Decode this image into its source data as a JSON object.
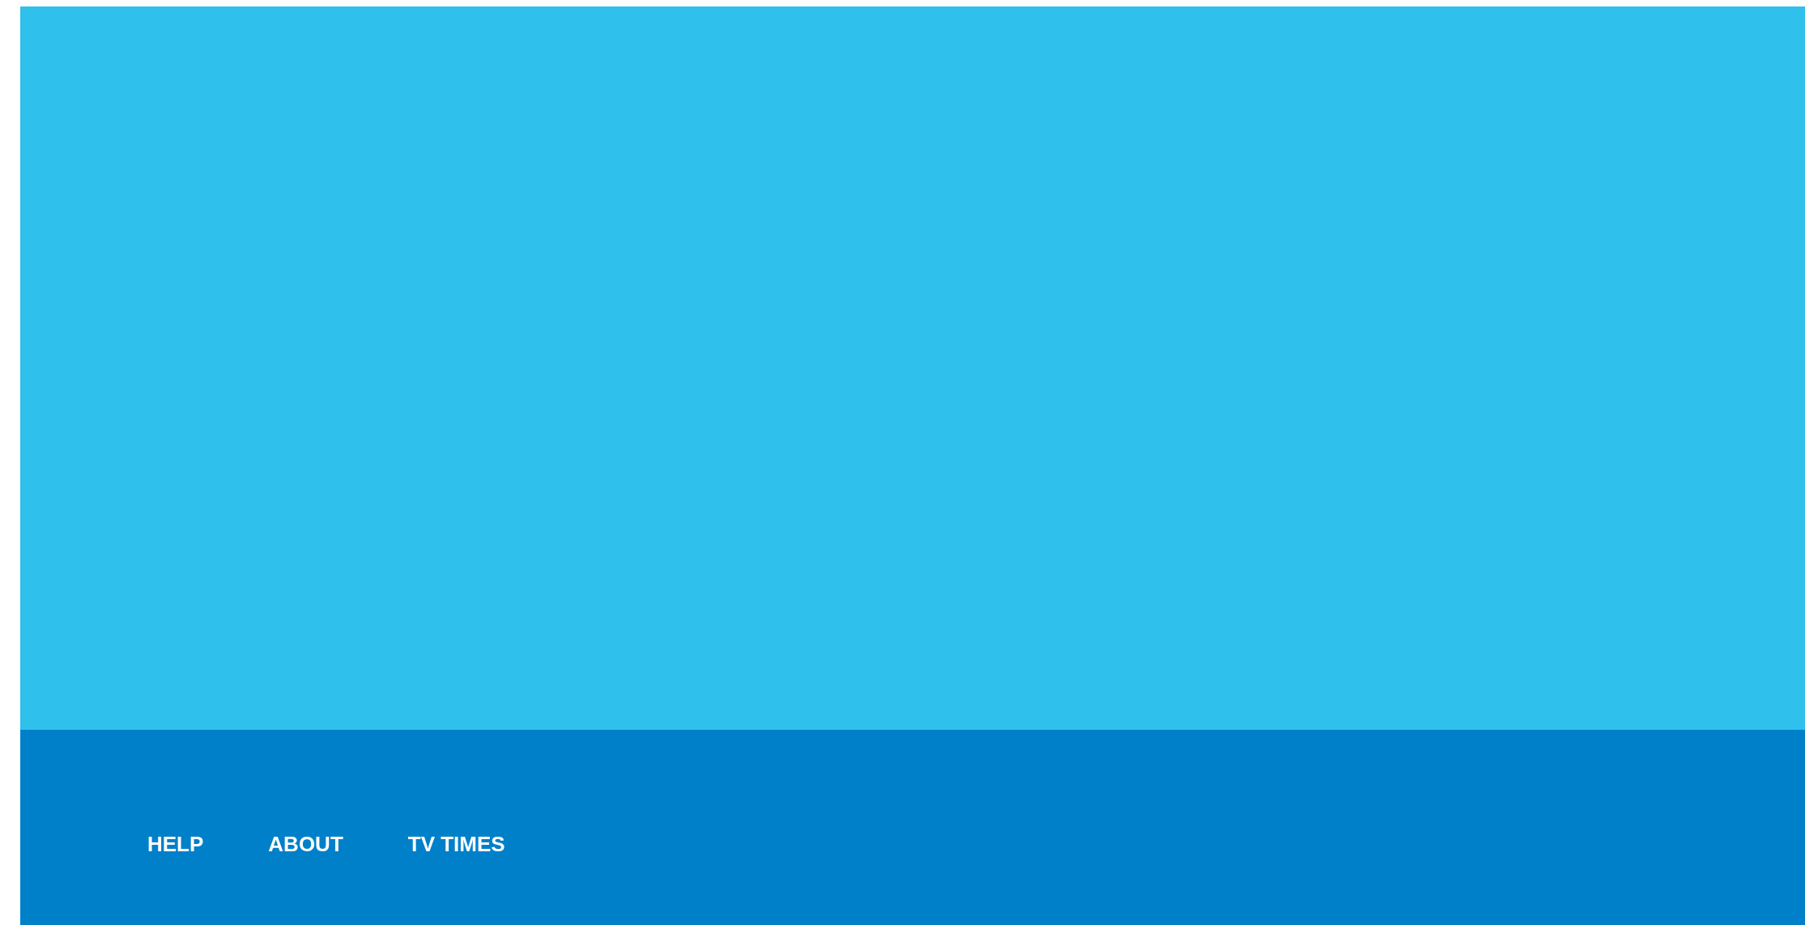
{
  "footer": {
    "links": [
      {
        "label": "HELP"
      },
      {
        "label": "ABOUT"
      },
      {
        "label": "TV TIMES"
      }
    ]
  }
}
